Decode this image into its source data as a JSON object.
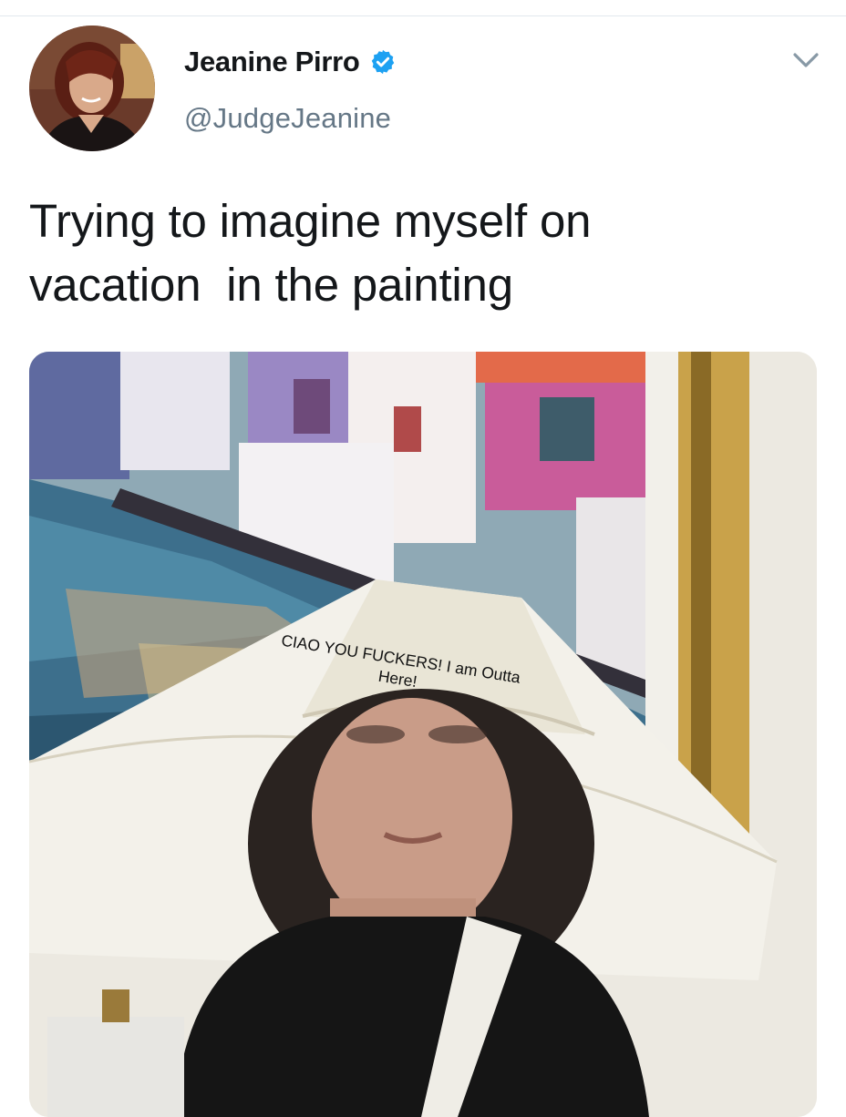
{
  "tweet": {
    "author": {
      "display_name": "Jeanine Pirro",
      "handle": "@JudgeJeanine",
      "verified": true,
      "avatar_icon": "profile-photo-avatar"
    },
    "menu_icon": "chevron-down-icon",
    "text": "Trying to imagine myself on\nvacation  in the painting",
    "media": {
      "caption_on_image": "CIAO YOU FUCKERS! I am Outta\nHere!",
      "icon": "photo-woman-lampshade-hat-painting"
    }
  },
  "colors": {
    "verified_blue": "#1da1f2",
    "secondary_text": "#657786",
    "divider": "#e1e8ed"
  }
}
